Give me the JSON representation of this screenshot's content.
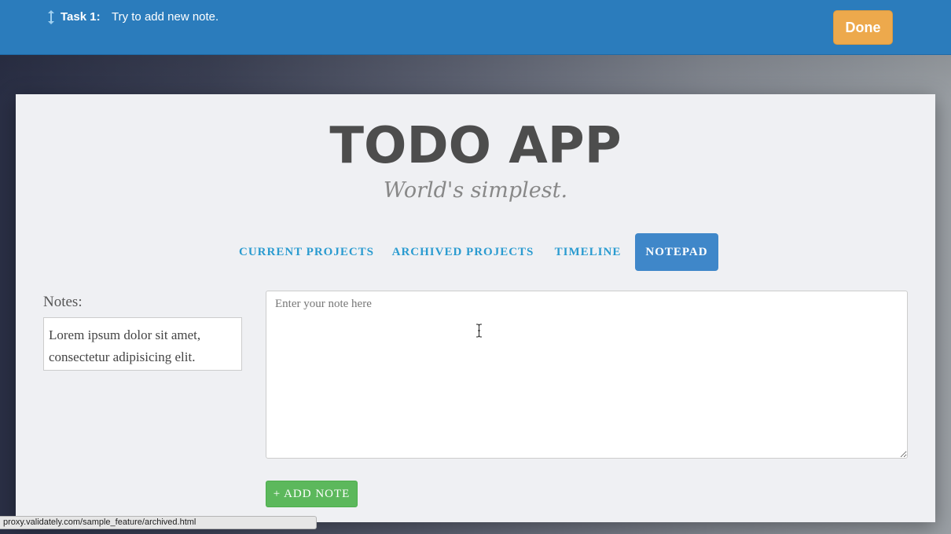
{
  "task_bar": {
    "label": "Task 1:",
    "text": "Try to add new note.",
    "done_label": "Done",
    "icon": "resize-vertical-icon"
  },
  "app": {
    "title": "TODO APP",
    "subtitle": "World's simplest."
  },
  "nav": {
    "items": [
      {
        "label": "CURRENT PROJECTS",
        "active": false
      },
      {
        "label": "ARCHIVED PROJECTS",
        "active": false
      },
      {
        "label": "TIMELINE",
        "active": false
      },
      {
        "label": "NOTEPAD",
        "active": true
      }
    ]
  },
  "notes": {
    "label": "Notes:",
    "items": [
      "Lorem ipsum dolor sit amet, consectetur adipisicing elit."
    ]
  },
  "editor": {
    "placeholder": "Enter your note here",
    "value": "",
    "add_button_label": "+ ADD NOTE"
  },
  "status_bar": {
    "url": "proxy.validately.com/sample_feature/archived.html"
  },
  "colors": {
    "taskbar": "#2b7cbc",
    "done_button": "#eda94c",
    "nav_link": "#2a9bd0",
    "nav_active": "#3f87c9",
    "add_button": "#5cb85c"
  }
}
